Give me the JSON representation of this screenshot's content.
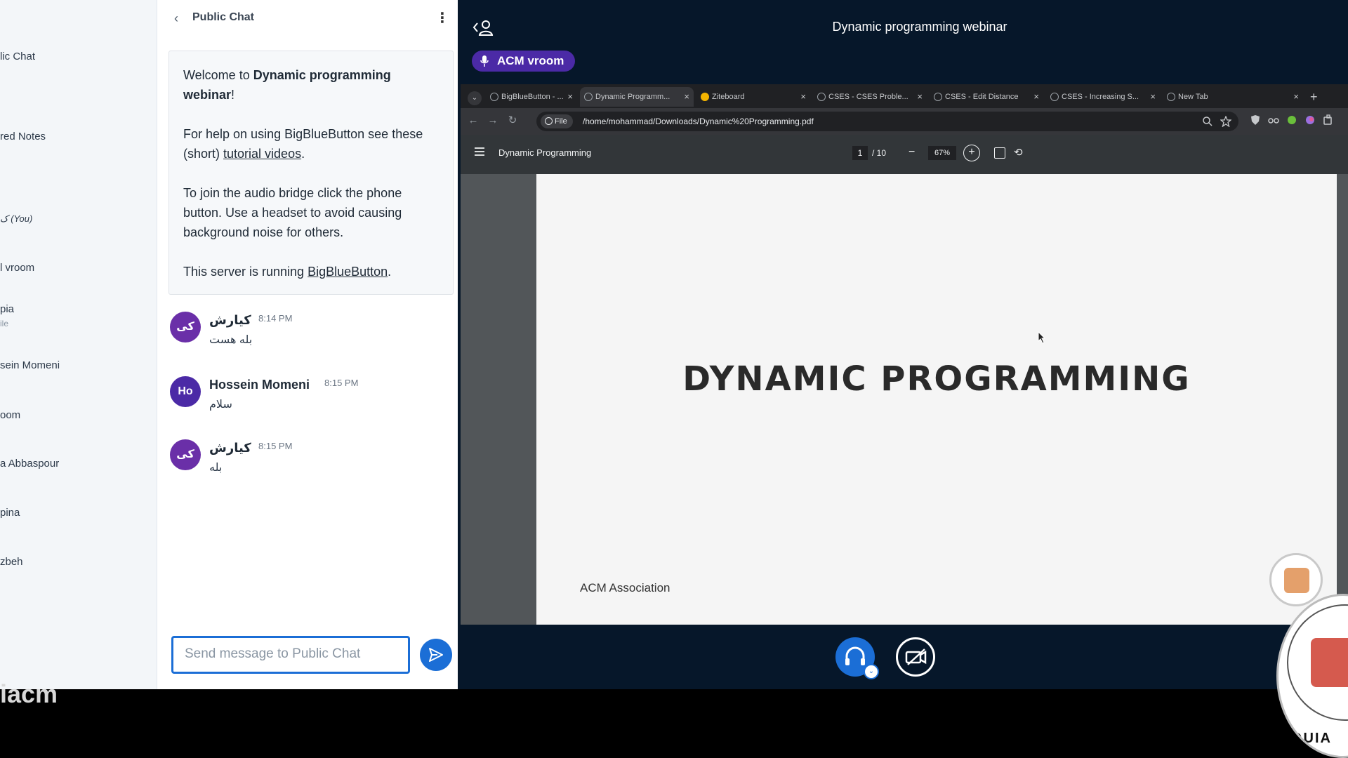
{
  "userlist": {
    "items": [
      {
        "label": "lic Chat"
      },
      {
        "label": "red Notes"
      },
      {
        "label": "ک (You)"
      },
      {
        "label": "l vroom"
      },
      {
        "label": "pia",
        "sub": "ile"
      },
      {
        "label": "sein Momeni"
      },
      {
        "label": "oom"
      },
      {
        "label": "a Abbaspour"
      },
      {
        "label": "pina"
      },
      {
        "label": "zbeh"
      }
    ]
  },
  "chat": {
    "title": "Public Chat",
    "welcome": {
      "line1_prefix": "Welcome to ",
      "line1_bold": "Dynamic programming webinar",
      "line1_suffix": "!",
      "help_prefix": "For help on using BigBlueButton see these (short) ",
      "help_link": "tutorial videos",
      "help_suffix": ".",
      "audio_text": "To join the audio bridge click the phone button. Use a headset to avoid causing background noise for others.",
      "server_prefix": "This server is running ",
      "server_link": "BigBlueButton",
      "server_suffix": "."
    },
    "messages": [
      {
        "avatar": "کی",
        "avatar_color": "#6a2fa8",
        "name": "کیارش",
        "time": "8:14 PM",
        "text": "بله هست"
      },
      {
        "avatar": "Ho",
        "avatar_color": "#4b2aa6",
        "name": "Hossein Momeni",
        "time": "8:15 PM",
        "text": "سلام"
      },
      {
        "avatar": "کی",
        "avatar_color": "#6a2fa8",
        "name": "کیارش",
        "time": "8:15 PM",
        "text": "بله"
      }
    ],
    "input_placeholder": "Send message to Public Chat"
  },
  "meeting": {
    "title": "Dynamic programming webinar",
    "talking_badge": "ACM vroom",
    "colors": {
      "primary": "#1b6ed6",
      "talking": "#4b2aa6",
      "background": "#06172a"
    }
  },
  "browser": {
    "tabs": [
      {
        "label": "BigBlueButton - ..."
      },
      {
        "label": "Dynamic Programm..."
      },
      {
        "label": "Ziteboard"
      },
      {
        "label": "CSES - CSES Proble..."
      },
      {
        "label": "CSES - Edit Distance"
      },
      {
        "label": "CSES - Increasing S..."
      },
      {
        "label": "New Tab"
      }
    ],
    "omnibox_scheme": "File",
    "url": "/home/mohammad/Downloads/Dynamic%20Programming.pdf"
  },
  "pdf": {
    "title": "Dynamic Programming",
    "page_current": "1",
    "page_total": "/ 10",
    "zoom": "67%",
    "document_heading": "DYNAMIC PROGRAMMING",
    "document_footer": "ACM Association"
  },
  "overlay": {
    "bottom_label": "iacm",
    "seal_text": "@UIA"
  }
}
